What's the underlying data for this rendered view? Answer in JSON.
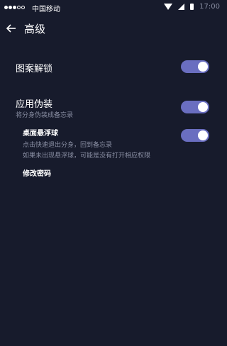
{
  "status_bar": {
    "carrier": "中国移动",
    "time": "17:00"
  },
  "header": {
    "title": "高级"
  },
  "settings": {
    "pattern_unlock": {
      "label": "图案解锁",
      "enabled": true
    },
    "app_disguise": {
      "label": "应用伪装",
      "description": "将分身伪装成备忘录",
      "enabled": true
    },
    "floating_ball": {
      "label": "桌面悬浮球",
      "description_line1": "点击快速退出分身，回到备忘录",
      "description_line2": "如果未出现悬浮球，可能是没有打开相应权限",
      "enabled": true
    },
    "change_password": {
      "label": "修改密码"
    }
  },
  "colors": {
    "background": "#171b2c",
    "toggle_track": "#6a6ec0",
    "toggle_knob": "#ffffff",
    "secondary_text": "#8a8fa3"
  }
}
